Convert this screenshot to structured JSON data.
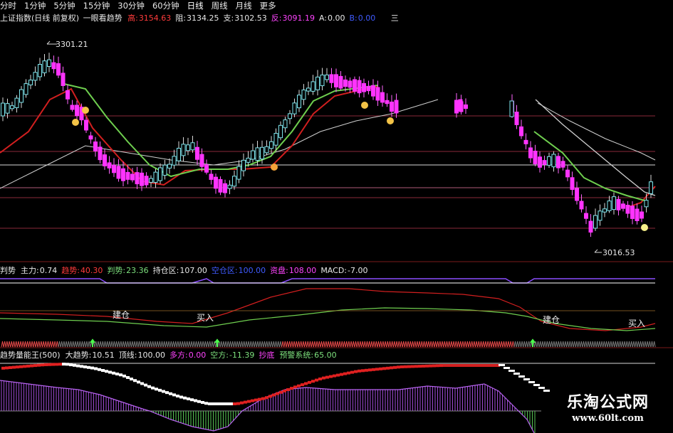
{
  "period_tabs": [
    {
      "label": "分时",
      "active": false
    },
    {
      "label": "1分钟",
      "active": false
    },
    {
      "label": "5分钟",
      "active": false
    },
    {
      "label": "15分钟",
      "active": false
    },
    {
      "label": "30分钟",
      "active": false
    },
    {
      "label": "60分钟",
      "active": false
    },
    {
      "label": "日线",
      "active": true
    },
    {
      "label": "周线",
      "active": false
    },
    {
      "label": "月线",
      "active": false
    },
    {
      "label": "更多",
      "active": false
    }
  ],
  "main_panel": {
    "title": "上证指数(日线 前复权)",
    "indicator_name": "一眼看趋势",
    "values": [
      {
        "label": "高:",
        "value": "3154.63",
        "color": "#ff3b3b"
      },
      {
        "label": "阻:",
        "value": "3134.25",
        "color": "#e8e8e8"
      },
      {
        "label": "支:",
        "value": "3102.53",
        "color": "#e8e8e8"
      },
      {
        "label": "反:",
        "value": "3091.19",
        "color": "#ff44ff"
      },
      {
        "label": "A:",
        "value": "0.00",
        "color": "#e8e8e8"
      },
      {
        "label": "B:",
        "value": "0.00",
        "color": "#3f5bff"
      }
    ],
    "extra_label": "三",
    "high_annotation": "3301.21",
    "low_annotation": "3016.53"
  },
  "panel2": {
    "values": [
      {
        "label": "判势",
        "value": "",
        "color": "#e8e8e8"
      },
      {
        "label": "主力:",
        "value": "0.74",
        "color": "#e8e8e8"
      },
      {
        "label": "趋势:",
        "value": "40.30",
        "color": "#ff3b3b"
      },
      {
        "label": "判势:",
        "value": "23.36",
        "color": "#7de07d"
      },
      {
        "label": "持仓区:",
        "value": "107.00",
        "color": "#e8e8e8"
      },
      {
        "label": "空仓区:",
        "value": "100.00",
        "color": "#3f5bff"
      },
      {
        "label": "资盘:",
        "value": "108.00",
        "color": "#ff44ff"
      },
      {
        "label": "MACD:",
        "value": "-7.00",
        "color": "#e8e8e8"
      }
    ],
    "signals": [
      "建仓",
      "买入",
      "建仓",
      "买入"
    ]
  },
  "panel3": {
    "values": [
      {
        "label": "趋势量能王(500)",
        "value": "",
        "color": "#e8e8e8"
      },
      {
        "label": "大趋势:",
        "value": "10.51",
        "color": "#e8e8e8"
      },
      {
        "label": "顶线:",
        "value": "100.00",
        "color": "#e8e8e8"
      },
      {
        "label": "多方:",
        "value": "0.00",
        "color": "#ff44ff"
      },
      {
        "label": "空方:",
        "value": "-11.39",
        "color": "#7de07d"
      },
      {
        "label": "抄底",
        "value": "",
        "color": "#ff44ff"
      },
      {
        "label": "预警系统:",
        "value": "65.00",
        "color": "#7de07d"
      }
    ]
  },
  "watermark": {
    "title": "乐淘公式网",
    "url": "www.60lt.com"
  }
}
